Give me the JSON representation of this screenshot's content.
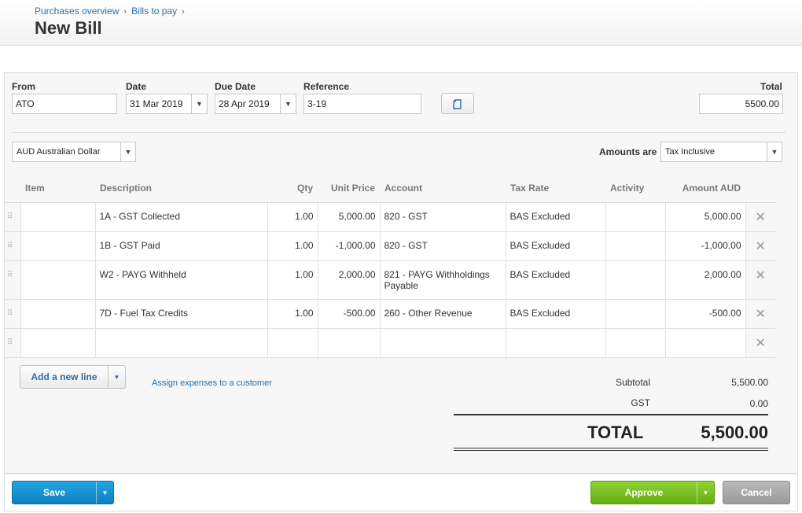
{
  "breadcrumb": {
    "item1": "Purchases overview",
    "item2": "Bills to pay",
    "sep": "›"
  },
  "page_title": "New Bill",
  "form": {
    "from_label": "From",
    "from_value": "ATO",
    "date_label": "Date",
    "date_value": "31 Mar 2019",
    "due_label": "Due Date",
    "due_value": "28 Apr 2019",
    "ref_label": "Reference",
    "ref_value": "3-19",
    "total_label": "Total",
    "total_value": "5500.00",
    "currency": "AUD Australian Dollar",
    "amounts_are_label": "Amounts are",
    "amounts_are_value": "Tax Inclusive"
  },
  "table": {
    "headers": {
      "item": "Item",
      "description": "Description",
      "qty": "Qty",
      "unit_price": "Unit Price",
      "account": "Account",
      "tax_rate": "Tax Rate",
      "activity": "Activity",
      "amount": "Amount AUD"
    },
    "rows": [
      {
        "item": "",
        "description": "1A - GST Collected",
        "qty": "1.00",
        "unit_price": "5,000.00",
        "account": "820 - GST",
        "tax_rate": "BAS Excluded",
        "activity": "",
        "amount": "5,000.00"
      },
      {
        "item": "",
        "description": "1B - GST Paid",
        "qty": "1.00",
        "unit_price": "-1,000.00",
        "account": "820 - GST",
        "tax_rate": "BAS Excluded",
        "activity": "",
        "amount": "-1,000.00"
      },
      {
        "item": "",
        "description": "W2 - PAYG Withheld",
        "qty": "1.00",
        "unit_price": "2,000.00",
        "account": "821 - PAYG Withholdings Payable",
        "tax_rate": "BAS Excluded",
        "activity": "",
        "amount": "2,000.00"
      },
      {
        "item": "",
        "description": "7D - Fuel Tax Credits",
        "qty": "1.00",
        "unit_price": "-500.00",
        "account": "260 - Other Revenue",
        "tax_rate": "BAS Excluded",
        "activity": "",
        "amount": "-500.00"
      },
      {
        "item": "",
        "description": "",
        "qty": "",
        "unit_price": "",
        "account": "",
        "tax_rate": "",
        "activity": "",
        "amount": ""
      }
    ],
    "drag_glyph": "⠿",
    "delete_glyph": "✕"
  },
  "actions": {
    "add_line": "Add a new line",
    "assign_link": "Assign expenses to a customer"
  },
  "summary": {
    "subtotal_label": "Subtotal",
    "subtotal_value": "5,500.00",
    "gst_label": "GST",
    "gst_value": "0.00",
    "total_label": "TOTAL",
    "total_value": "5,500.00"
  },
  "footer": {
    "save": "Save",
    "approve": "Approve",
    "cancel": "Cancel"
  },
  "colors": {
    "link": "#2a6fa8",
    "save": "#1a96d4",
    "approve": "#7bc025",
    "cancel": "#aaaaaa"
  }
}
